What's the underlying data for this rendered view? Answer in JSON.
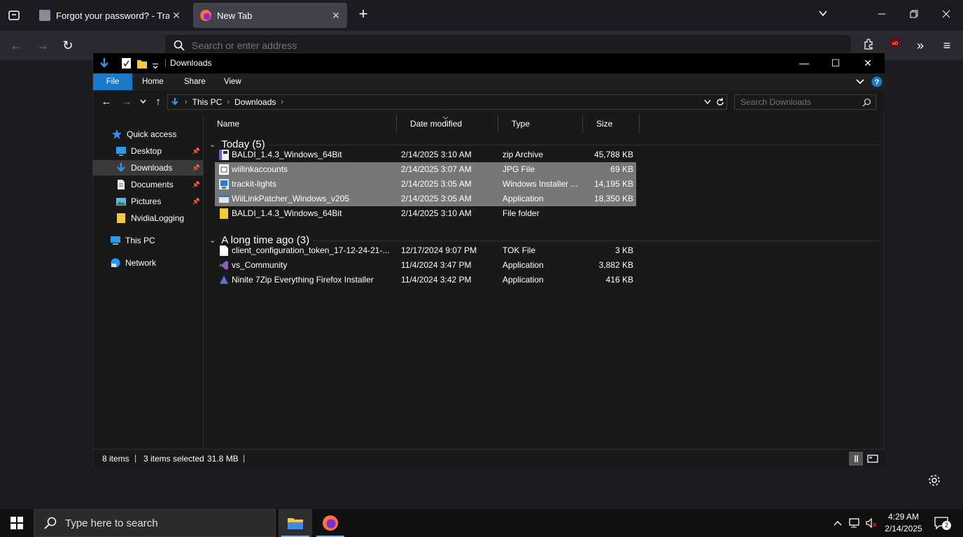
{
  "browser": {
    "tabs": [
      {
        "title": "Forgot your password? - Trackit",
        "close": "✕"
      },
      {
        "title": "New Tab",
        "close": "✕"
      }
    ],
    "new_tab": "+",
    "urlbar_placeholder": "Search or enter address",
    "window_controls": {
      "list": "⌄",
      "minimize": "—",
      "restore": "❐",
      "close": "✕"
    }
  },
  "explorer": {
    "title": "Downloads",
    "ribbon_tabs": [
      "File",
      "Home",
      "Share",
      "View"
    ],
    "breadcrumb": [
      "This PC",
      "Downloads"
    ],
    "search_placeholder": "Search Downloads",
    "window_controls": {
      "minimize": "—",
      "maximize": "☐",
      "close": "✕"
    },
    "nav": [
      {
        "label": "Quick access",
        "icon": "star-icon"
      },
      {
        "label": "Desktop",
        "icon": "desktop-icon",
        "pinned": true
      },
      {
        "label": "Downloads",
        "icon": "download-icon",
        "pinned": true,
        "selected": true
      },
      {
        "label": "Documents",
        "icon": "documents-icon",
        "pinned": true
      },
      {
        "label": "Pictures",
        "icon": "pictures-icon",
        "pinned": true
      },
      {
        "label": "NvidiaLogging",
        "icon": "folder-icon"
      },
      {
        "label": "This PC",
        "icon": "computer-icon"
      },
      {
        "label": "Network",
        "icon": "network-icon"
      }
    ],
    "columns": [
      "Name",
      "Date modified",
      "Type",
      "Size"
    ],
    "groups": [
      {
        "label": "Today (5)",
        "files": [
          {
            "name": "BALDI_1.4.3_Windows_64Bit",
            "date": "2/14/2025 3:10 AM",
            "type": "zip Archive",
            "size": "45,788 KB",
            "icon": "zip-icon",
            "selected": false
          },
          {
            "name": "wiilinkaccounts",
            "date": "2/14/2025 3:07 AM",
            "type": "JPG File",
            "size": "69 KB",
            "icon": "image-file-icon",
            "selected": true
          },
          {
            "name": "trackit-lights",
            "date": "2/14/2025 3:05 AM",
            "type": "Windows Installer ...",
            "size": "14,195 KB",
            "icon": "installer-icon",
            "selected": true
          },
          {
            "name": "WiiLinkPatcher_Windows_v205",
            "date": "2/14/2025 3:05 AM",
            "type": "Application",
            "size": "18,350 KB",
            "icon": "application-icon",
            "selected": true
          },
          {
            "name": "BALDI_1.4.3_Windows_64Bit",
            "date": "2/14/2025 3:10 AM",
            "type": "File folder",
            "size": "",
            "icon": "folder-icon",
            "selected": false
          }
        ]
      },
      {
        "label": "A long time ago (3)",
        "files": [
          {
            "name": "client_configuration_token_17-12-24-21-...",
            "date": "12/17/2024 9:07 PM",
            "type": "TOK File",
            "size": "3 KB",
            "icon": "blank-file-icon",
            "selected": false
          },
          {
            "name": "vs_Community",
            "date": "11/4/2024 3:47 PM",
            "type": "Application",
            "size": "3,882 KB",
            "icon": "visual-studio-icon",
            "selected": false
          },
          {
            "name": "Ninite 7Zip Everything Firefox Installer",
            "date": "11/4/2024 3:42 PM",
            "type": "Application",
            "size": "416 KB",
            "icon": "ninite-icon",
            "selected": false
          }
        ]
      }
    ],
    "status": {
      "items": "8 items",
      "selected": "3 items selected",
      "size": "31.8 MB",
      "sep": "|"
    }
  },
  "taskbar": {
    "search_placeholder": "Type here to search",
    "time": "4:29 AM",
    "date": "2/14/2025",
    "notifications": "2"
  },
  "colors": {
    "accent": "#1979ca",
    "selection": "#777777",
    "firefox_orange": "#ff7139"
  }
}
